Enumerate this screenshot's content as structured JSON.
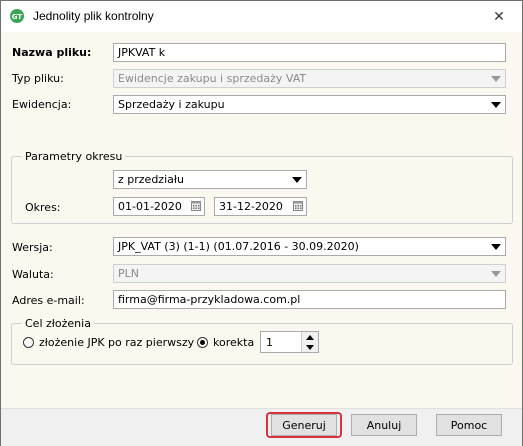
{
  "window": {
    "title": "Jednolity plik kontrolny",
    "close_symbol": "✕"
  },
  "form": {
    "file_name": {
      "label": "Nazwa pliku:",
      "value": "JPKVAT k"
    },
    "file_type": {
      "label": "Typ pliku:",
      "value": "Ewidencje zakupu i sprzedaży VAT"
    },
    "register": {
      "label": "Ewidencja:",
      "value": "Sprzedaży i zakupu"
    },
    "period_group": {
      "title": "Parametry okresu",
      "mode": "z przedziału",
      "label": "Okres:",
      "date_from": "01-01-2020",
      "date_to": "31-12-2020"
    },
    "version": {
      "label": "Wersja:",
      "value": "JPK_VAT (3) (1-1) (01.07.2016 - 30.09.2020)"
    },
    "currency": {
      "label": "Waluta:",
      "value": "PLN"
    },
    "email": {
      "label": "Adres e-mail:",
      "value": "firma@firma-przykladowa.com.pl"
    },
    "purpose_group": {
      "title": "Cel złożenia",
      "option_first": "złożenie JPK po raz pierwszy",
      "option_correction": "korekta",
      "selected": "korekta",
      "correction_number": "1"
    }
  },
  "buttons": {
    "generate": "Generuj",
    "cancel": "Anuluj",
    "help": "Pomoc"
  },
  "colors": {
    "highlight": "#d8333b",
    "client_bg": "#fbf8f0"
  }
}
